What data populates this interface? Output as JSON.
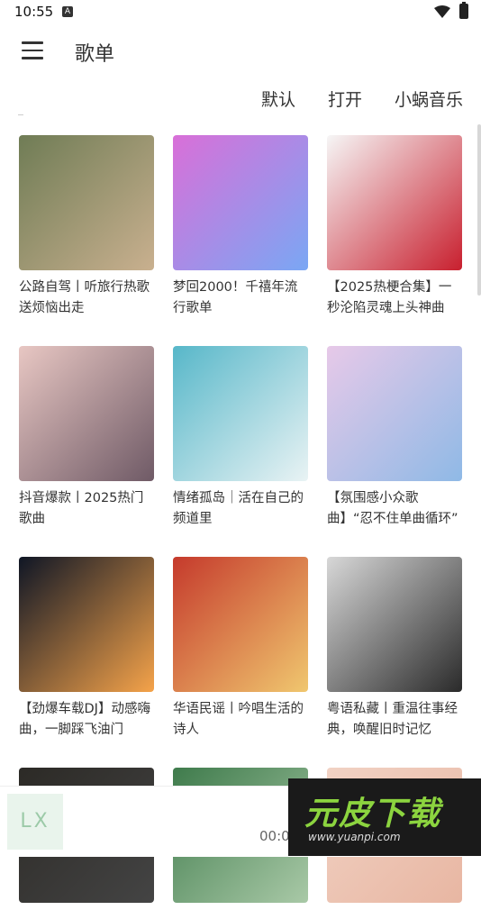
{
  "status": {
    "time": "10:55"
  },
  "header": {
    "title": "歌单"
  },
  "sources": [
    "默认",
    "打开",
    "小蜗音乐"
  ],
  "playlists": [
    {
      "title": "公路自驾丨听旅行热歌送烦恼出走",
      "cover": [
        "#6f7c55",
        "#c9b08f"
      ]
    },
    {
      "title": "梦回2000！千禧年流行歌单",
      "cover": [
        "#d96fd8",
        "#7aa7f4"
      ]
    },
    {
      "title": "【2025热梗合集】一秒沦陷灵魂上头神曲",
      "cover": [
        "#f6f6f6",
        "#c81f2e"
      ]
    },
    {
      "title": "抖音爆款丨2025热门歌曲",
      "cover": [
        "#e8c7c3",
        "#6f5a66"
      ]
    },
    {
      "title": "情绪孤岛｜活在自己的频道里",
      "cover": [
        "#57b7c9",
        "#e9f3f4"
      ]
    },
    {
      "title": "【氛围感小众歌曲】“忍不住单曲循环”",
      "cover": [
        "#e7c9e8",
        "#8fb9e6"
      ]
    },
    {
      "title": "【劲爆车载DJ】动感嗨曲，一脚踩飞油门",
      "cover": [
        "#0f1625",
        "#f5a34a"
      ]
    },
    {
      "title": "华语民谣丨吟唱生活的诗人",
      "cover": [
        "#c53a2c",
        "#f0c76f"
      ]
    },
    {
      "title": "粤语私藏丨重温往事经典，唤醒旧时记忆",
      "cover": [
        "#d8d8d8",
        "#2a2a2a"
      ]
    },
    {
      "title": "",
      "cover": [
        "#2c2a26",
        "#444"
      ]
    },
    {
      "title": "",
      "cover": [
        "#3f7b4c",
        "#a9c9a7"
      ]
    },
    {
      "title": "",
      "cover": [
        "#f1d2c4",
        "#e8b6a2"
      ]
    }
  ],
  "player": {
    "logo": "LX",
    "time": "00:00"
  },
  "watermark": {
    "main": "元皮下载",
    "url": "www.yuanpi.com"
  }
}
